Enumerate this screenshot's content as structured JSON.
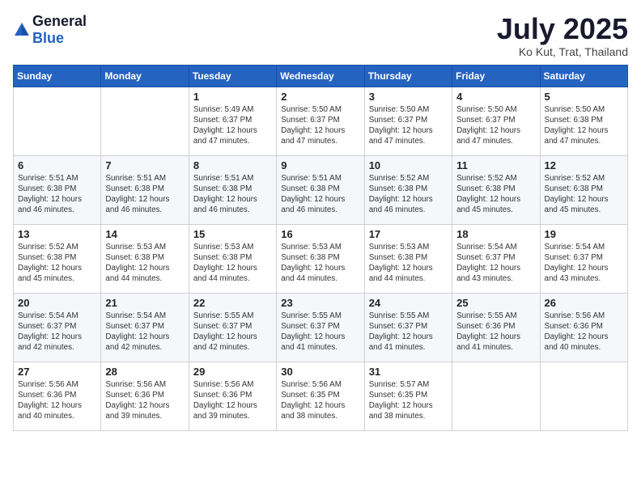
{
  "header": {
    "logo_general": "General",
    "logo_blue": "Blue",
    "month_year": "July 2025",
    "location": "Ko Kut, Trat, Thailand"
  },
  "days_of_week": [
    "Sunday",
    "Monday",
    "Tuesday",
    "Wednesday",
    "Thursday",
    "Friday",
    "Saturday"
  ],
  "weeks": [
    [
      {
        "day": "",
        "sunrise": "",
        "sunset": "",
        "daylight": ""
      },
      {
        "day": "",
        "sunrise": "",
        "sunset": "",
        "daylight": ""
      },
      {
        "day": "1",
        "sunrise": "Sunrise: 5:49 AM",
        "sunset": "Sunset: 6:37 PM",
        "daylight": "Daylight: 12 hours and 47 minutes."
      },
      {
        "day": "2",
        "sunrise": "Sunrise: 5:50 AM",
        "sunset": "Sunset: 6:37 PM",
        "daylight": "Daylight: 12 hours and 47 minutes."
      },
      {
        "day": "3",
        "sunrise": "Sunrise: 5:50 AM",
        "sunset": "Sunset: 6:37 PM",
        "daylight": "Daylight: 12 hours and 47 minutes."
      },
      {
        "day": "4",
        "sunrise": "Sunrise: 5:50 AM",
        "sunset": "Sunset: 6:37 PM",
        "daylight": "Daylight: 12 hours and 47 minutes."
      },
      {
        "day": "5",
        "sunrise": "Sunrise: 5:50 AM",
        "sunset": "Sunset: 6:38 PM",
        "daylight": "Daylight: 12 hours and 47 minutes."
      }
    ],
    [
      {
        "day": "6",
        "sunrise": "Sunrise: 5:51 AM",
        "sunset": "Sunset: 6:38 PM",
        "daylight": "Daylight: 12 hours and 46 minutes."
      },
      {
        "day": "7",
        "sunrise": "Sunrise: 5:51 AM",
        "sunset": "Sunset: 6:38 PM",
        "daylight": "Daylight: 12 hours and 46 minutes."
      },
      {
        "day": "8",
        "sunrise": "Sunrise: 5:51 AM",
        "sunset": "Sunset: 6:38 PM",
        "daylight": "Daylight: 12 hours and 46 minutes."
      },
      {
        "day": "9",
        "sunrise": "Sunrise: 5:51 AM",
        "sunset": "Sunset: 6:38 PM",
        "daylight": "Daylight: 12 hours and 46 minutes."
      },
      {
        "day": "10",
        "sunrise": "Sunrise: 5:52 AM",
        "sunset": "Sunset: 6:38 PM",
        "daylight": "Daylight: 12 hours and 46 minutes."
      },
      {
        "day": "11",
        "sunrise": "Sunrise: 5:52 AM",
        "sunset": "Sunset: 6:38 PM",
        "daylight": "Daylight: 12 hours and 45 minutes."
      },
      {
        "day": "12",
        "sunrise": "Sunrise: 5:52 AM",
        "sunset": "Sunset: 6:38 PM",
        "daylight": "Daylight: 12 hours and 45 minutes."
      }
    ],
    [
      {
        "day": "13",
        "sunrise": "Sunrise: 5:52 AM",
        "sunset": "Sunset: 6:38 PM",
        "daylight": "Daylight: 12 hours and 45 minutes."
      },
      {
        "day": "14",
        "sunrise": "Sunrise: 5:53 AM",
        "sunset": "Sunset: 6:38 PM",
        "daylight": "Daylight: 12 hours and 44 minutes."
      },
      {
        "day": "15",
        "sunrise": "Sunrise: 5:53 AM",
        "sunset": "Sunset: 6:38 PM",
        "daylight": "Daylight: 12 hours and 44 minutes."
      },
      {
        "day": "16",
        "sunrise": "Sunrise: 5:53 AM",
        "sunset": "Sunset: 6:38 PM",
        "daylight": "Daylight: 12 hours and 44 minutes."
      },
      {
        "day": "17",
        "sunrise": "Sunrise: 5:53 AM",
        "sunset": "Sunset: 6:38 PM",
        "daylight": "Daylight: 12 hours and 44 minutes."
      },
      {
        "day": "18",
        "sunrise": "Sunrise: 5:54 AM",
        "sunset": "Sunset: 6:37 PM",
        "daylight": "Daylight: 12 hours and 43 minutes."
      },
      {
        "day": "19",
        "sunrise": "Sunrise: 5:54 AM",
        "sunset": "Sunset: 6:37 PM",
        "daylight": "Daylight: 12 hours and 43 minutes."
      }
    ],
    [
      {
        "day": "20",
        "sunrise": "Sunrise: 5:54 AM",
        "sunset": "Sunset: 6:37 PM",
        "daylight": "Daylight: 12 hours and 42 minutes."
      },
      {
        "day": "21",
        "sunrise": "Sunrise: 5:54 AM",
        "sunset": "Sunset: 6:37 PM",
        "daylight": "Daylight: 12 hours and 42 minutes."
      },
      {
        "day": "22",
        "sunrise": "Sunrise: 5:55 AM",
        "sunset": "Sunset: 6:37 PM",
        "daylight": "Daylight: 12 hours and 42 minutes."
      },
      {
        "day": "23",
        "sunrise": "Sunrise: 5:55 AM",
        "sunset": "Sunset: 6:37 PM",
        "daylight": "Daylight: 12 hours and 41 minutes."
      },
      {
        "day": "24",
        "sunrise": "Sunrise: 5:55 AM",
        "sunset": "Sunset: 6:37 PM",
        "daylight": "Daylight: 12 hours and 41 minutes."
      },
      {
        "day": "25",
        "sunrise": "Sunrise: 5:55 AM",
        "sunset": "Sunset: 6:36 PM",
        "daylight": "Daylight: 12 hours and 41 minutes."
      },
      {
        "day": "26",
        "sunrise": "Sunrise: 5:56 AM",
        "sunset": "Sunset: 6:36 PM",
        "daylight": "Daylight: 12 hours and 40 minutes."
      }
    ],
    [
      {
        "day": "27",
        "sunrise": "Sunrise: 5:56 AM",
        "sunset": "Sunset: 6:36 PM",
        "daylight": "Daylight: 12 hours and 40 minutes."
      },
      {
        "day": "28",
        "sunrise": "Sunrise: 5:56 AM",
        "sunset": "Sunset: 6:36 PM",
        "daylight": "Daylight: 12 hours and 39 minutes."
      },
      {
        "day": "29",
        "sunrise": "Sunrise: 5:56 AM",
        "sunset": "Sunset: 6:36 PM",
        "daylight": "Daylight: 12 hours and 39 minutes."
      },
      {
        "day": "30",
        "sunrise": "Sunrise: 5:56 AM",
        "sunset": "Sunset: 6:35 PM",
        "daylight": "Daylight: 12 hours and 38 minutes."
      },
      {
        "day": "31",
        "sunrise": "Sunrise: 5:57 AM",
        "sunset": "Sunset: 6:35 PM",
        "daylight": "Daylight: 12 hours and 38 minutes."
      },
      {
        "day": "",
        "sunrise": "",
        "sunset": "",
        "daylight": ""
      },
      {
        "day": "",
        "sunrise": "",
        "sunset": "",
        "daylight": ""
      }
    ]
  ]
}
